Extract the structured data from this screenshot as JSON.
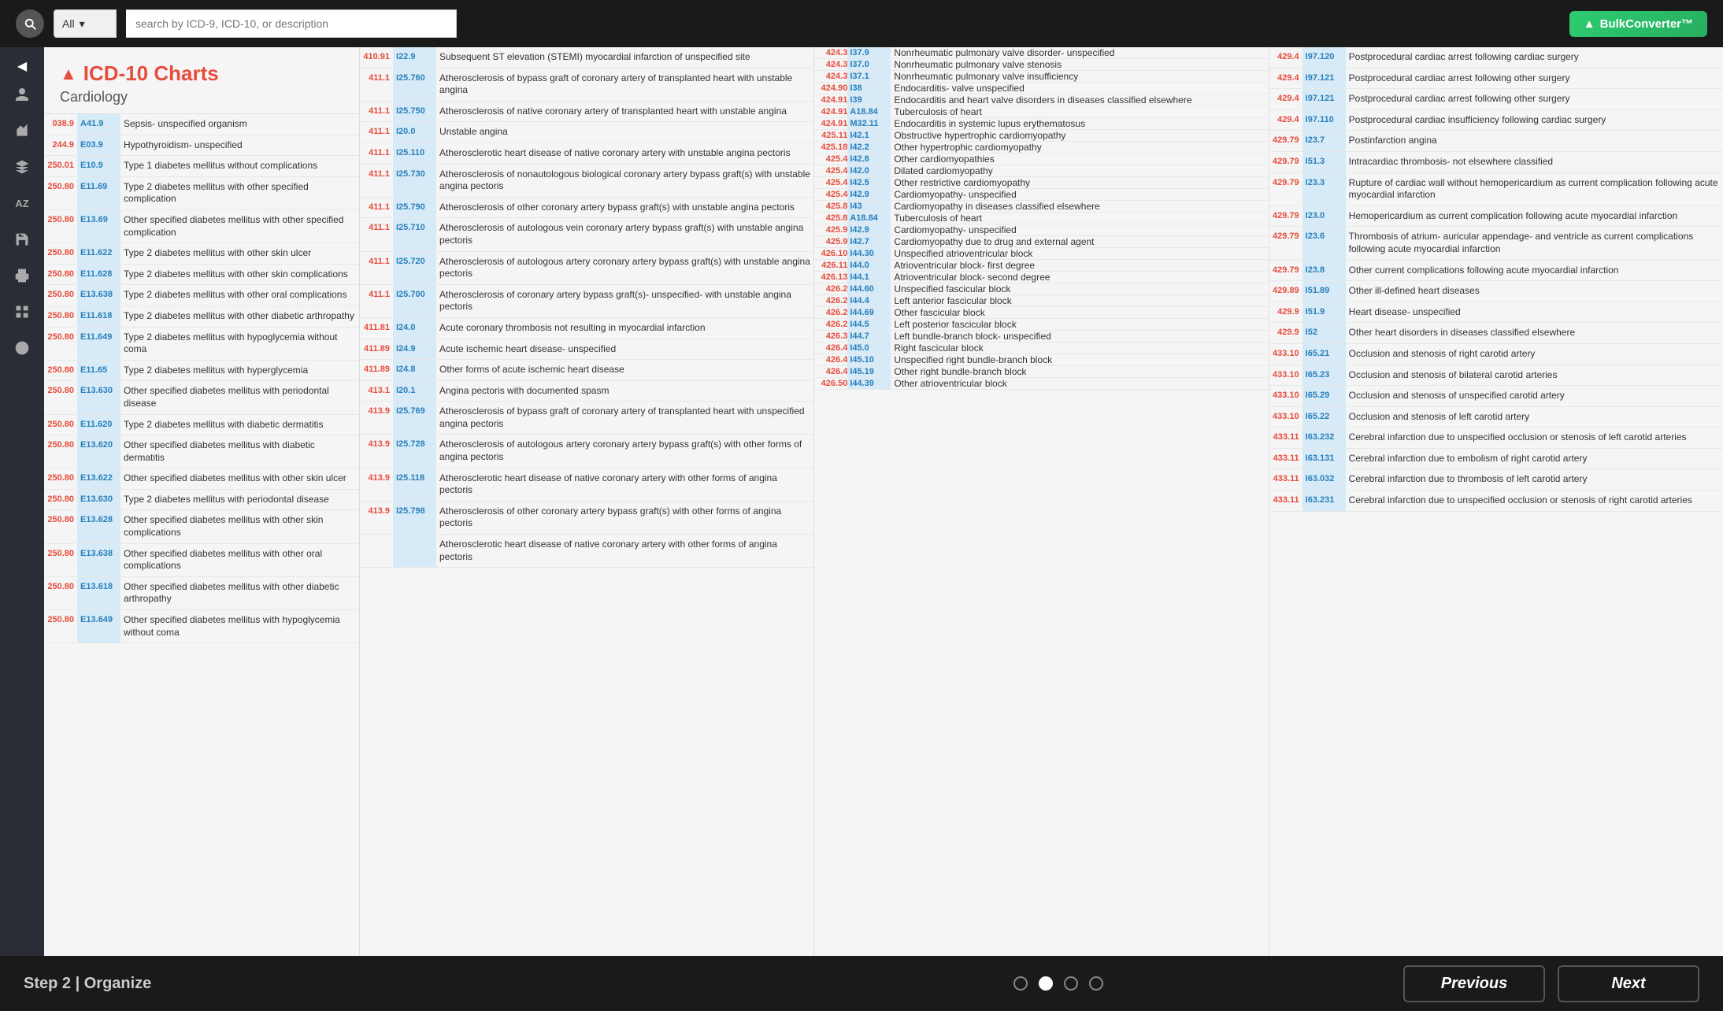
{
  "topbar": {
    "search_placeholder": "search by ICD-9, ICD-10, or description",
    "all_label": "All",
    "bulk_btn": "BulkConverter™"
  },
  "sidebar": {
    "items": [
      {
        "name": "chevron-left",
        "icon": "◀"
      },
      {
        "name": "person",
        "icon": "👤"
      },
      {
        "name": "chart",
        "icon": "📊"
      },
      {
        "name": "tool",
        "icon": "⚙"
      },
      {
        "name": "az",
        "icon": "AZ"
      },
      {
        "name": "save",
        "icon": "💾"
      },
      {
        "name": "print",
        "icon": "🖨"
      },
      {
        "name": "grid",
        "icon": "▦"
      },
      {
        "name": "info",
        "icon": "ℹ"
      }
    ]
  },
  "left_panel": {
    "title_prefix": "ICD-",
    "title_num": "10",
    "title_suffix": " Charts",
    "subtitle": "Cardiology",
    "rows": [
      {
        "icd9": "038.9",
        "icd10": "A41.9",
        "desc": "Sepsis- unspecified organism"
      },
      {
        "icd9": "244.9",
        "icd10": "E03.9",
        "desc": "Hypothyroidism- unspecified"
      },
      {
        "icd9": "250.01",
        "icd10": "E10.9",
        "desc": "Type 1 diabetes mellitus without complications"
      },
      {
        "icd9": "250.80",
        "icd10": "E11.69",
        "desc": "Type 2 diabetes mellitus with other specified complication"
      },
      {
        "icd9": "250.80",
        "icd10": "E13.69",
        "desc": "Other specified diabetes mellitus with other specified complication"
      },
      {
        "icd9": "250.80",
        "icd10": "E11.622",
        "desc": "Type 2 diabetes mellitus with other skin ulcer"
      },
      {
        "icd9": "250.80",
        "icd10": "E11.628",
        "desc": "Type 2 diabetes mellitus with other skin complications"
      },
      {
        "icd9": "250.80",
        "icd10": "E13.638",
        "desc": "Type 2 diabetes mellitus with other oral complications"
      },
      {
        "icd9": "250.80",
        "icd10": "E11.618",
        "desc": "Type 2 diabetes mellitus with other diabetic arthropathy"
      },
      {
        "icd9": "250.80",
        "icd10": "E11.649",
        "desc": "Type 2 diabetes mellitus with hypoglycemia without coma"
      },
      {
        "icd9": "250.80",
        "icd10": "E11.65",
        "desc": "Type 2 diabetes mellitus with hyperglycemia"
      },
      {
        "icd9": "250.80",
        "icd10": "E13.630",
        "desc": "Other specified diabetes mellitus with periodontal disease"
      },
      {
        "icd9": "250.80",
        "icd10": "E11.620",
        "desc": "Type 2 diabetes mellitus with diabetic dermatitis"
      },
      {
        "icd9": "250.80",
        "icd10": "E13.620",
        "desc": "Other specified diabetes mellitus with diabetic dermatitis"
      },
      {
        "icd9": "250.80",
        "icd10": "E13.622",
        "desc": "Other specified diabetes mellitus with other skin ulcer"
      },
      {
        "icd9": "250.80",
        "icd10": "E13.630",
        "desc": "Type 2 diabetes mellitus with periodontal disease"
      },
      {
        "icd9": "250.80",
        "icd10": "E13.628",
        "desc": "Other specified diabetes mellitus with other skin complications"
      },
      {
        "icd9": "250.80",
        "icd10": "E13.638",
        "desc": "Other specified diabetes mellitus with other oral complications"
      },
      {
        "icd9": "250.80",
        "icd10": "E13.618",
        "desc": "Other specified diabetes mellitus with other diabetic arthropathy"
      },
      {
        "icd9": "250.80",
        "icd10": "E13.649",
        "desc": "Other specified diabetes mellitus with hypoglycemia without coma"
      }
    ]
  },
  "middle_table": {
    "rows": [
      {
        "icd9": "410.91",
        "icd10": "I22.9",
        "desc": "Subsequent ST elevation (STEMI) myocardial infarction of unspecified site"
      },
      {
        "icd9": "411.1",
        "icd10": "I25.760",
        "desc": "Atherosclerosis of bypass graft of coronary artery of transplanted heart with unstable angina"
      },
      {
        "icd9": "411.1",
        "icd10": "I25.750",
        "desc": "Atherosclerosis of native coronary artery of transplanted heart with unstable angina"
      },
      {
        "icd9": "411.1",
        "icd10": "I20.0",
        "desc": "Unstable angina"
      },
      {
        "icd9": "411.1",
        "icd10": "I25.110",
        "desc": "Atherosclerotic heart disease of native coronary artery with unstable angina pectoris"
      },
      {
        "icd9": "411.1",
        "icd10": "I25.730",
        "desc": "Atherosclerosis of nonautologous biological coronary artery bypass graft(s) with unstable angina pectoris"
      },
      {
        "icd9": "411.1",
        "icd10": "I25.790",
        "desc": "Atherosclerosis of other coronary artery bypass graft(s) with unstable angina pectoris"
      },
      {
        "icd9": "411.1",
        "icd10": "I25.710",
        "desc": "Atherosclerosis of autologous vein coronary artery bypass graft(s) with unstable angina pectoris"
      },
      {
        "icd9": "411.1",
        "icd10": "I25.720",
        "desc": "Atherosclerosis of autologous artery coronary artery bypass graft(s) with unstable angina pectoris"
      },
      {
        "icd9": "411.1",
        "icd10": "I25.700",
        "desc": "Atherosclerosis of coronary artery bypass graft(s)- unspecified- with unstable angina pectoris"
      },
      {
        "icd9": "411.81",
        "icd10": "I24.0",
        "desc": "Acute coronary thrombosis not resulting in myocardial infarction"
      },
      {
        "icd9": "411.89",
        "icd10": "I24.9",
        "desc": "Acute ischemic heart disease- unspecified"
      },
      {
        "icd9": "411.89",
        "icd10": "I24.8",
        "desc": "Other forms of acute ischemic heart disease"
      },
      {
        "icd9": "413.1",
        "icd10": "I20.1",
        "desc": "Angina pectoris with documented spasm"
      },
      {
        "icd9": "413.9",
        "icd10": "I25.769",
        "desc": "Atherosclerosis of bypass graft of coronary artery of transplanted heart with unspecified angina pectoris"
      },
      {
        "icd9": "413.9",
        "icd10": "I25.728",
        "desc": "Atherosclerosis of autologous artery coronary artery bypass graft(s) with other forms of angina pectoris"
      },
      {
        "icd9": "413.9",
        "icd10": "I25.118",
        "desc": "Atherosclerotic heart disease of native coronary artery with other forms of angina pectoris"
      },
      {
        "icd9": "413.9",
        "icd10": "I25.798",
        "desc": "Atherosclerosis of other coronary artery bypass graft(s) with other forms of angina pectoris"
      },
      {
        "icd9": "",
        "icd10": "",
        "desc": "Atherosclerotic heart disease of native coronary artery with other forms of angina pectoris"
      }
    ]
  },
  "col2_table": {
    "rows": [
      {
        "icd9": "424.3",
        "icd10": "I37.9",
        "desc": "Nonrheumatic pulmonary valve disorder- unspecified"
      },
      {
        "icd9": "424.3",
        "icd10": "I37.0",
        "desc": "Nonrheumatic pulmonary valve stenosis"
      },
      {
        "icd9": "424.3",
        "icd10": "I37.1",
        "desc": "Nonrheumatic pulmonary valve insufficiency"
      },
      {
        "icd9": "424.90",
        "icd10": "I38",
        "desc": "Endocarditis- valve unspecified"
      },
      {
        "icd9": "424.91",
        "icd10": "I39",
        "desc": "Endocarditis and heart valve disorders in diseases classified elsewhere"
      },
      {
        "icd9": "424.91",
        "icd10": "A18.84",
        "desc": "Tuberculosis of heart"
      },
      {
        "icd9": "424.91",
        "icd10": "M32.11",
        "desc": "Endocarditis in systemic lupus erythematosus"
      },
      {
        "icd9": "425.11",
        "icd10": "I42.1",
        "desc": "Obstructive hypertrophic cardiomyopathy"
      },
      {
        "icd9": "425.18",
        "icd10": "I42.2",
        "desc": "Other hypertrophic cardiomyopathy"
      },
      {
        "icd9": "425.4",
        "icd10": "I42.8",
        "desc": "Other cardiomyopathies"
      },
      {
        "icd9": "425.4",
        "icd10": "I42.0",
        "desc": "Dilated cardiomyopathy"
      },
      {
        "icd9": "425.4",
        "icd10": "I42.5",
        "desc": "Other restrictive cardiomyopathy"
      },
      {
        "icd9": "425.4",
        "icd10": "I42.9",
        "desc": "Cardiomyopathy- unspecified"
      },
      {
        "icd9": "425.8",
        "icd10": "I43",
        "desc": "Cardiomyopathy in diseases classified elsewhere"
      },
      {
        "icd9": "425.8",
        "icd10": "A18.84",
        "desc": "Tuberculosis of heart"
      },
      {
        "icd9": "425.9",
        "icd10": "I42.9",
        "desc": "Cardiomyopathy- unspecified"
      },
      {
        "icd9": "425.9",
        "icd10": "I42.7",
        "desc": "Cardiomyopathy due to drug and external agent"
      },
      {
        "icd9": "426.10",
        "icd10": "I44.30",
        "desc": "Unspecified atrioventricular block"
      },
      {
        "icd9": "426.11",
        "icd10": "I44.0",
        "desc": "Atrioventricular block- first degree"
      },
      {
        "icd9": "426.13",
        "icd10": "I44.1",
        "desc": "Atrioventricular block- second degree"
      },
      {
        "icd9": "426.2",
        "icd10": "I44.60",
        "desc": "Unspecified fascicular block"
      },
      {
        "icd9": "426.2",
        "icd10": "I44.4",
        "desc": "Left anterior fascicular block"
      },
      {
        "icd9": "426.2",
        "icd10": "I44.69",
        "desc": "Other fascicular block"
      },
      {
        "icd9": "426.2",
        "icd10": "I44.5",
        "desc": "Left posterior fascicular block"
      },
      {
        "icd9": "426.3",
        "icd10": "I44.7",
        "desc": "Left bundle-branch block- unspecified"
      },
      {
        "icd9": "426.4",
        "icd10": "I45.0",
        "desc": "Right fascicular block"
      },
      {
        "icd9": "426.4",
        "icd10": "I45.10",
        "desc": "Unspecified right bundle-branch block"
      },
      {
        "icd9": "426.4",
        "icd10": "I45.19",
        "desc": "Other right bundle-branch block"
      },
      {
        "icd9": "426.50",
        "icd10": "I44.39",
        "desc": "Other atrioventricular block"
      }
    ]
  },
  "right_table": {
    "rows": [
      {
        "icd9": "429.4",
        "icd10": "I97.120",
        "desc": "Postprocedural cardiac arrest following cardiac surgery"
      },
      {
        "icd9": "429.4",
        "icd10": "I97.121",
        "desc": "Postprocedural cardiac arrest following other surgery"
      },
      {
        "icd9": "429.4",
        "icd10": "I97.121",
        "desc": "Postprocedural cardiac arrest following other surgery"
      },
      {
        "icd9": "429.4",
        "icd10": "I97.110",
        "desc": "Postprocedural cardiac insufficiency following cardiac surgery"
      },
      {
        "icd9": "429.79",
        "icd10": "I23.7",
        "desc": "Postinfarction angina"
      },
      {
        "icd9": "429.79",
        "icd10": "I51.3",
        "desc": "Intracardiac thrombosis- not elsewhere classified"
      },
      {
        "icd9": "429.79",
        "icd10": "I23.3",
        "desc": "Rupture of cardiac wall without hemopericardium as current complication following acute myocardial infarction"
      },
      {
        "icd9": "429.79",
        "icd10": "I23.0",
        "desc": "Hemopericardium as current complication following acute myocardial infarction"
      },
      {
        "icd9": "429.79",
        "icd10": "I23.6",
        "desc": "Thrombosis of atrium- auricular appendage- and ventricle as current complications following acute myocardial infarction"
      },
      {
        "icd9": "429.79",
        "icd10": "I23.8",
        "desc": "Other current complications following acute myocardial infarction"
      },
      {
        "icd9": "429.89",
        "icd10": "I51.89",
        "desc": "Other ill-defined heart diseases"
      },
      {
        "icd9": "429.9",
        "icd10": "I51.9",
        "desc": "Heart disease- unspecified"
      },
      {
        "icd9": "429.9",
        "icd10": "I52",
        "desc": "Other heart disorders in diseases classified elsewhere"
      },
      {
        "icd9": "433.10",
        "icd10": "I65.21",
        "desc": "Occlusion and stenosis of right carotid artery"
      },
      {
        "icd9": "433.10",
        "icd10": "I65.23",
        "desc": "Occlusion and stenosis of bilateral carotid arteries"
      },
      {
        "icd9": "433.10",
        "icd10": "I65.29",
        "desc": "Occlusion and stenosis of unspecified carotid artery"
      },
      {
        "icd9": "433.10",
        "icd10": "I65.22",
        "desc": "Occlusion and stenosis of left carotid artery"
      },
      {
        "icd9": "433.11",
        "icd10": "I63.232",
        "desc": "Cerebral infarction due to unspecified occlusion or stenosis of left carotid arteries"
      },
      {
        "icd9": "433.11",
        "icd10": "I63.131",
        "desc": "Cerebral infarction due to embolism of right carotid artery"
      },
      {
        "icd9": "433.11",
        "icd10": "I63.032",
        "desc": "Cerebral infarction due to thrombosis of left carotid artery"
      },
      {
        "icd9": "433.11",
        "icd10": "I63.231",
        "desc": "Cerebral infarction due to unspecified occlusion or stenosis of right carotid arteries"
      }
    ]
  },
  "bottom": {
    "step_label": "Step 2 | Organize",
    "prev_label": "Previous",
    "next_label": "Next",
    "dots": [
      {
        "active": false
      },
      {
        "active": true
      },
      {
        "active": false
      },
      {
        "active": false
      }
    ]
  }
}
